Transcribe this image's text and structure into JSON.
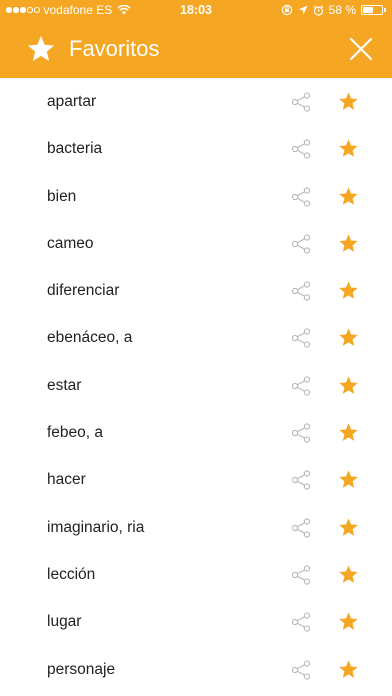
{
  "status_bar": {
    "carrier": "vodafone ES",
    "time": "18:03",
    "battery": "58 %",
    "battery_level": 0.58,
    "signal_bars": 3
  },
  "header": {
    "title": "Favoritos",
    "star_icon": "star-icon",
    "close_icon": "close-icon"
  },
  "colors": {
    "accent": "#f5a623",
    "star": "#f5a623",
    "share_icon": "#b8b8b8",
    "text": "#222222"
  },
  "favorites": [
    {
      "word": "apartar"
    },
    {
      "word": "bacteria"
    },
    {
      "word": "bien"
    },
    {
      "word": "cameo"
    },
    {
      "word": "diferenciar"
    },
    {
      "word": "ebenáceo, a"
    },
    {
      "word": "estar"
    },
    {
      "word": "febeo, a"
    },
    {
      "word": "hacer"
    },
    {
      "word": "imaginario, ria"
    },
    {
      "word": "lección"
    },
    {
      "word": "lugar"
    },
    {
      "word": "personaje"
    }
  ]
}
